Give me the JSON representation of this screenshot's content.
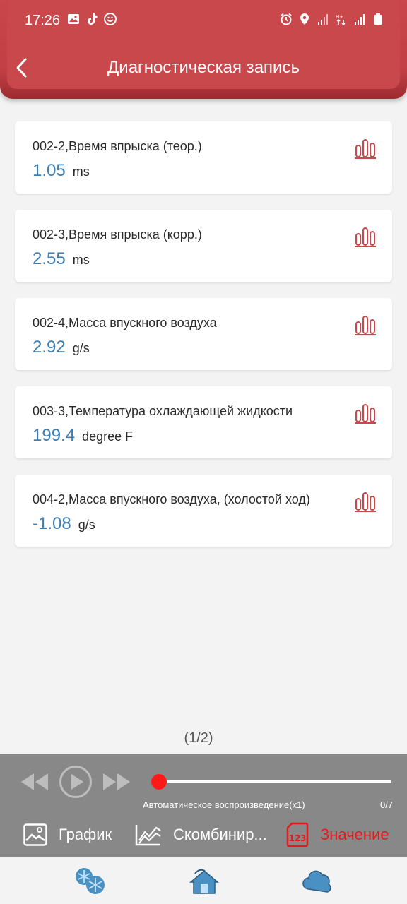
{
  "status_bar": {
    "time": "17:26",
    "left_icons": [
      "image-icon",
      "tiktok-icon",
      "emoji-icon"
    ],
    "right_icons": [
      "alarm-icon",
      "location-icon",
      "signal-icon",
      "data-icon",
      "signal-icon",
      "battery-icon"
    ]
  },
  "header": {
    "title": "Диагностическая запись",
    "back_icon": "chevron-left-icon"
  },
  "records": [
    {
      "label": "002-2,Время впрыска (теор.)",
      "value": "1.05",
      "unit": "ms"
    },
    {
      "label": "002-3,Время впрыска (корр.)",
      "value": "2.55",
      "unit": "ms"
    },
    {
      "label": "002-4,Масса впускного воздуха",
      "value": "2.92",
      "unit": "g/s"
    },
    {
      "label": "003-3,Температура охлаждающей жидкости",
      "value": "199.4",
      "unit": "degree F"
    },
    {
      "label": "004-2,Масса впускного воздуха, (холостой ход)",
      "value": "-1.08",
      "unit": "g/s"
    }
  ],
  "pager": {
    "text": "(1/2)"
  },
  "player": {
    "autoplay_label": "Автоматическое воспроизведение(x1)",
    "counter": "0/7",
    "progress": 0
  },
  "tabs": [
    {
      "label": "График",
      "icon": "image-icon"
    },
    {
      "label": "Скомбинир...",
      "icon": "line-chart-icon"
    },
    {
      "label": "Значение",
      "icon": "value-123-icon",
      "active": true
    }
  ],
  "bottom_nav": {
    "icons": [
      "snowflake-icon",
      "home-icon",
      "cloud-icon"
    ]
  },
  "colors": {
    "header_red": "#c9484c",
    "value_blue": "#3d7fb3",
    "active_red": "#e41b1b",
    "knob_red": "#ff1a1a",
    "panel_gray": "#888888"
  }
}
